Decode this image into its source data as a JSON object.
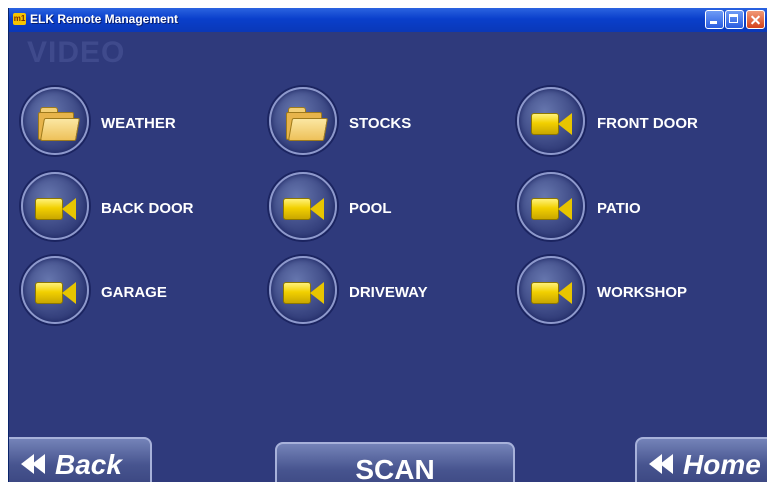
{
  "window": {
    "title": "ELK Remote Management",
    "app_icon_text": "m1"
  },
  "page": {
    "title": "VIDEO"
  },
  "tiles": [
    {
      "label": "WEATHER",
      "icon": "folder-icon"
    },
    {
      "label": "STOCKS",
      "icon": "folder-icon"
    },
    {
      "label": "FRONT DOOR",
      "icon": "camera-icon"
    },
    {
      "label": "BACK DOOR",
      "icon": "camera-icon"
    },
    {
      "label": "POOL",
      "icon": "camera-icon"
    },
    {
      "label": "PATIO",
      "icon": "camera-icon"
    },
    {
      "label": "GARAGE",
      "icon": "camera-icon"
    },
    {
      "label": "DRIVEWAY",
      "icon": "camera-icon"
    },
    {
      "label": "WORKSHOP",
      "icon": "camera-icon"
    }
  ],
  "nav": {
    "back_label": "Back",
    "scan_label": "SCAN",
    "home_label": "Home"
  },
  "colors": {
    "background": "#2f3a7c",
    "titlebar": "#0a3fcb",
    "camera": "#f2d000",
    "folder": "#e7b44b"
  }
}
